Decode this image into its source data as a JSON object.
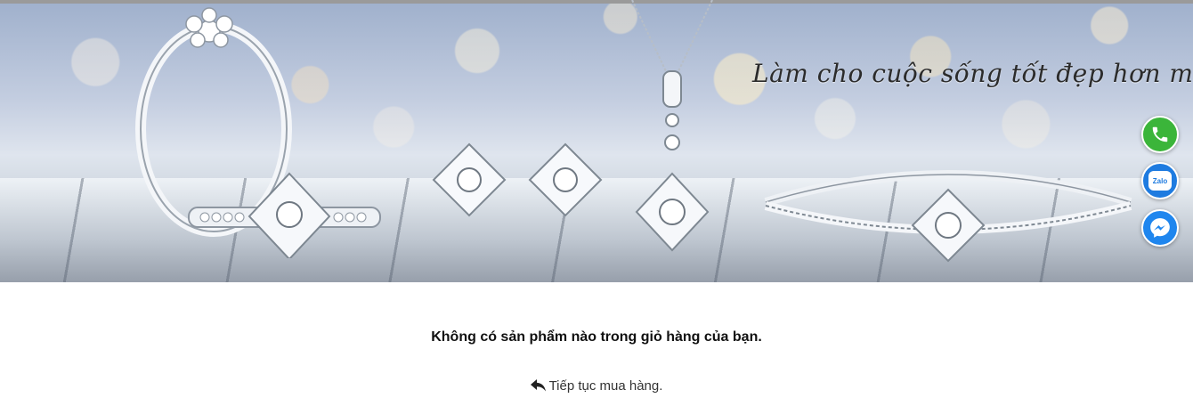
{
  "banner": {
    "tagline": "Làm cho cuộc sống tốt đẹp hơn mỗi ngày"
  },
  "contact": {
    "zalo_label": "Zalo"
  },
  "cart": {
    "empty_message": "Không có sản phẩm nào trong giỏ hàng của bạn.",
    "continue_label": "Tiếp tục mua hàng."
  },
  "icons": [
    "phone-icon",
    "zalo-icon",
    "messenger-icon",
    "reply-arrow-icon"
  ],
  "colors": {
    "phone": "#3bb53a",
    "zalo": "#1e7be0",
    "messenger": "#1f86ee",
    "text": "#111111"
  }
}
